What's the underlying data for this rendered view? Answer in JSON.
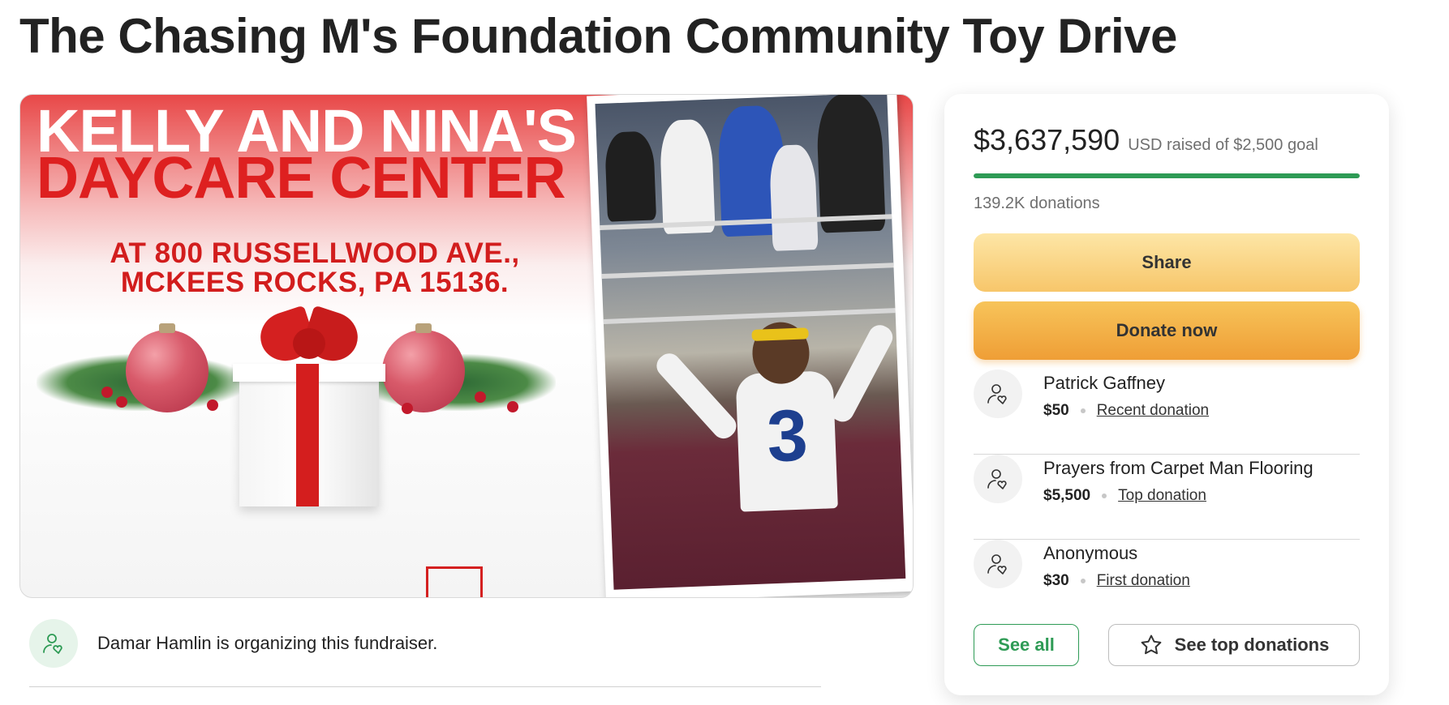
{
  "page": {
    "title": "The Chasing M's Foundation Community Toy Drive"
  },
  "hero": {
    "headline_line1": "KELLY AND NINA'S",
    "headline_line2": "DAYCARE CENTER",
    "address_line1": "AT 800 RUSSELLWOOD AVE.,",
    "address_line2": "MCKEES ROCKS, PA 15136.",
    "jersey_number": "3"
  },
  "organizer": {
    "text": "Damar Hamlin is organizing this fundraiser.",
    "icon": "user-heart-icon",
    "icon_color": "#2e9b55"
  },
  "fundraiser": {
    "raised_amount": "$3,637,590",
    "raised_suffix": "USD raised of $2,500 goal",
    "progress_fraction": 1.0,
    "progress_color": "#2e9b55",
    "donations_count": "139.2K donations",
    "share_label": "Share",
    "donate_label": "Donate now",
    "donors": [
      {
        "name": "Patrick Gaffney",
        "amount": "$50",
        "tag": "Recent donation"
      },
      {
        "name": "Prayers from Carpet Man Flooring",
        "amount": "$5,500",
        "tag": "Top donation"
      },
      {
        "name": "Anonymous",
        "amount": "$30",
        "tag": "First donation"
      }
    ],
    "see_all_label": "See all",
    "see_top_label": "See top donations",
    "see_top_icon": "star-outline-icon"
  }
}
